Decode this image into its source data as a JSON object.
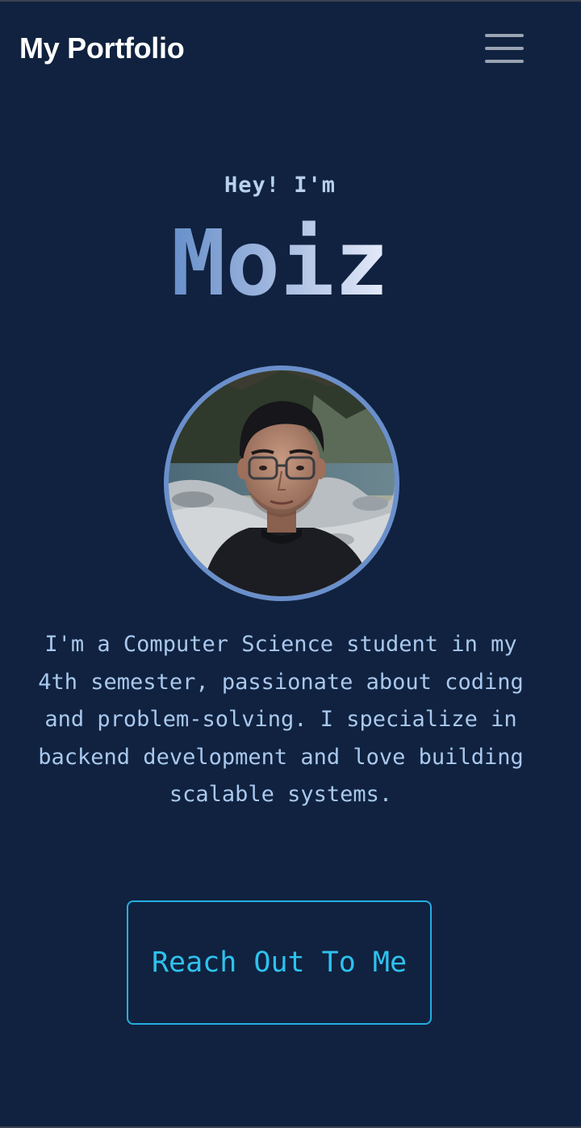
{
  "navbar": {
    "brand": "My Portfolio",
    "menu_icon": "hamburger-menu-icon"
  },
  "hero": {
    "greeting": "Hey! I'm",
    "name": "Moiz",
    "name_gradient": [
      "#2e66b3",
      "#9fb6de",
      "#ffffff"
    ],
    "photo_alt": "Profile photo",
    "bio": "I'm a Computer Science student in my 4th semester, passionate about coding and problem-solving. I specialize in backend development and love building scalable systems.",
    "cta_label": "Reach Out To Me"
  },
  "colors": {
    "background": "#10223f",
    "accent": "#2ec2ee",
    "avatar_border": "#6a8fcb",
    "bio_text": "#a9c8ee"
  }
}
